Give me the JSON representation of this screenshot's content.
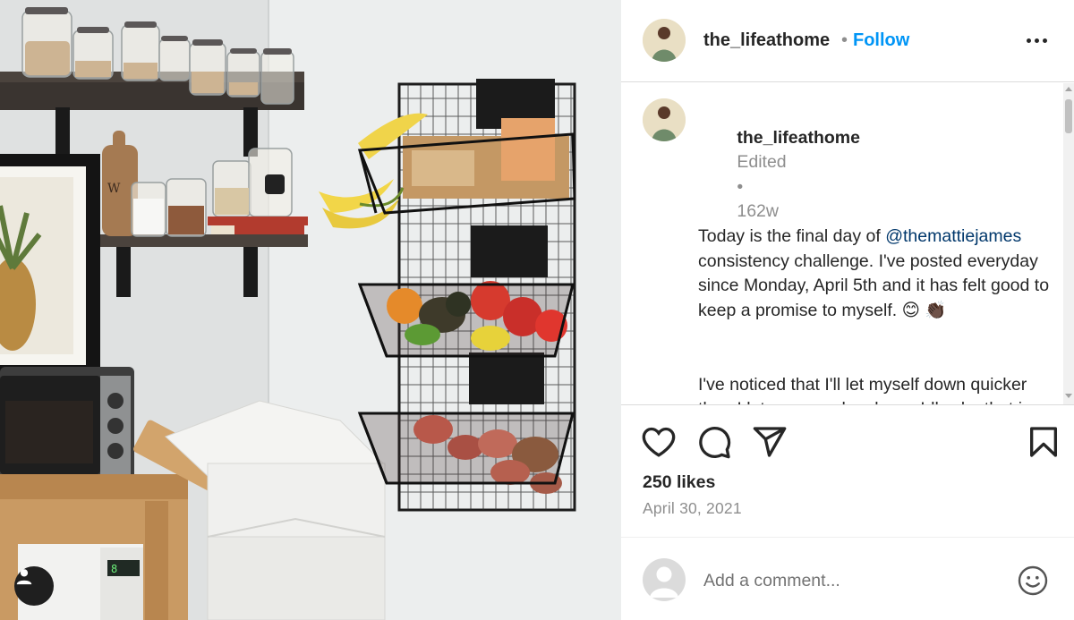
{
  "post": {
    "username": "the_lifeathome",
    "separator": "•",
    "follow_label": "Follow",
    "more_label": "More options"
  },
  "caption": {
    "username": "the_lifeathome",
    "edited": "Edited",
    "separator": "•",
    "age": "162w",
    "text_before": "Today is the final day of ",
    "mention": "@themattiejames",
    "text_after": " consistency challenge. I've posted everyday since Monday, April 5th and it has felt good to keep a promise to myself. 😊 👏🏿",
    "paragraph2": "I've noticed that I'll let myself down quicker than I let anyone else down. Idk why that is. Maybe I know I'll forgive myself....At least in the short term. But in the long term, I know that will catch up with me."
  },
  "actions": {
    "like_icon": "heart-icon",
    "comment_icon": "comment-icon",
    "share_icon": "send-icon",
    "save_icon": "bookmark-icon"
  },
  "likes": "250 likes",
  "date": "April 30, 2021",
  "comment_box": {
    "placeholder": "Add a comment...",
    "emoji_icon": "smiley-icon"
  },
  "colors": {
    "link": "#0095f6",
    "mention": "#00376b",
    "muted": "#8e8e8e",
    "text": "#262626",
    "border": "#dbdbdb"
  }
}
